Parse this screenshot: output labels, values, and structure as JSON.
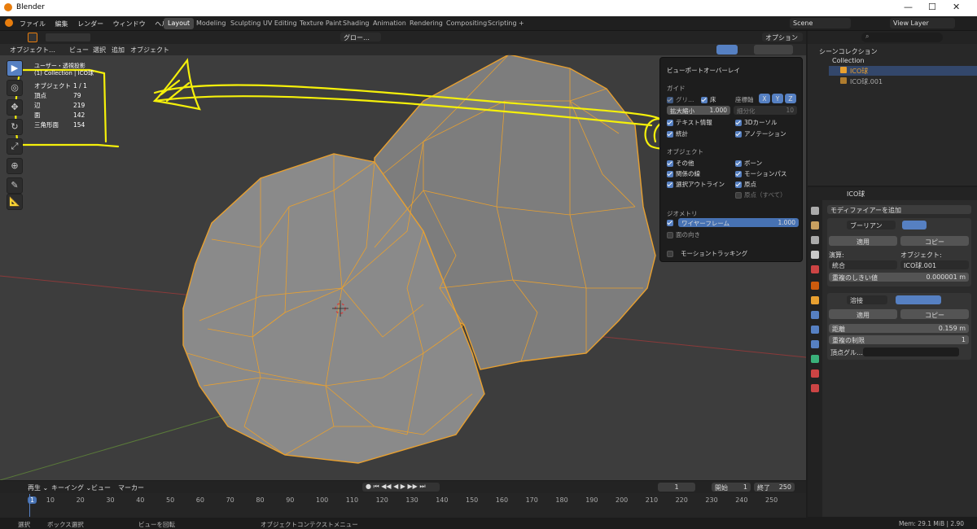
{
  "app": {
    "title": "Blender",
    "window_controls": [
      "—",
      "☐",
      "✕"
    ]
  },
  "menu": [
    "ファイル",
    "編集",
    "レンダー",
    "ウィンドウ",
    "ヘルプ"
  ],
  "workspaces": [
    {
      "label": "Layout",
      "active": true
    },
    {
      "label": "Modeling"
    },
    {
      "label": "Sculpting"
    },
    {
      "label": "UV Editing"
    },
    {
      "label": "Texture Paint"
    },
    {
      "label": "Shading"
    },
    {
      "label": "Animation"
    },
    {
      "label": "Rendering"
    },
    {
      "label": "Compositing"
    },
    {
      "label": "Scripting"
    },
    {
      "label": "+"
    }
  ],
  "scene": {
    "name": "Scene",
    "view_layer": "View Layer"
  },
  "viewport_header": {
    "mode": "オブジェクト…",
    "menus": [
      "ビュー",
      "選択",
      "追加",
      "オブジェクト"
    ],
    "orientation": "グロー…",
    "options": "オプション ⌄"
  },
  "viewport_info": {
    "line1": "ユーザー・透視投影",
    "line2": "(1) Collection | ICO球"
  },
  "stats": [
    {
      "label": "オブジェクト",
      "value": "1 / 1"
    },
    {
      "label": "頂点",
      "value": "79"
    },
    {
      "label": "辺",
      "value": "219"
    },
    {
      "label": "面",
      "value": "142"
    },
    {
      "label": "三角形面",
      "value": "154"
    }
  ],
  "overlay_panel": {
    "title": "ビューポートオーバーレイ",
    "guides_label": "ガイド",
    "grid": "グリ…",
    "floor": "床",
    "axes_label": "座標軸",
    "axes": [
      "X",
      "Y",
      "Z"
    ],
    "scale_label": "拡大縮小",
    "scale_value": "1.000",
    "subdiv_label": "細分化",
    "subdiv_value": "10",
    "text_info": "テキスト情報",
    "cursor3d": "3Dカーソル",
    "statistics": "統計",
    "annotation": "アノテーション",
    "objects_label": "オブジェクト",
    "extras": "その他",
    "bones": "ボーン",
    "relations": "関係の線",
    "motion_paths": "モーションパス",
    "outline_selected": "選択アウトライン",
    "origins": "原点",
    "origins_all": "原点（すべて）",
    "geometry_label": "ジオメトリ",
    "wireframe": "ワイヤーフレーム",
    "wireframe_value": "1.000",
    "face_orientation": "面の向き",
    "motion_tracking": "モーショントラッキング"
  },
  "outliner": {
    "root": "シーンコレクション",
    "collection": "Collection",
    "items": [
      "ICO球",
      "ICO球.001"
    ]
  },
  "properties": {
    "object_name": "ICO球",
    "add_modifier": "モディファイアーを追加",
    "mod1": {
      "name": "ブーリアン",
      "apply": "適用",
      "copy": "コピー",
      "op_label": "演算:",
      "op_value": "統合",
      "obj_label": "オブジェクト:",
      "obj_value": "ICO球.001",
      "threshold_label": "重複のしきい値",
      "threshold_value": "0.000001 m"
    },
    "mod2": {
      "name": "溶接",
      "apply": "適用",
      "copy": "コピー",
      "dist_label": "距離",
      "dist_value": "0.159 m",
      "dup_label": "重複の制限",
      "dup_value": "1",
      "vgroup_label": "頂点グル…"
    }
  },
  "timeline": {
    "menus": [
      "再生 ⌄",
      "キーイング ⌄",
      "ビュー",
      "マーカー"
    ],
    "frame": "1",
    "start_label": "開始",
    "start": "1",
    "end_label": "終了",
    "end": "250",
    "ticks": [
      "1",
      "10",
      "20",
      "30",
      "40",
      "50",
      "60",
      "70",
      "80",
      "90",
      "100",
      "110",
      "120",
      "130",
      "140",
      "150",
      "160",
      "170",
      "180",
      "190",
      "200",
      "210",
      "220",
      "230",
      "240",
      "250"
    ]
  },
  "status": {
    "select": "選択",
    "box": "ボックス選択",
    "rotate": "ビューを回転",
    "context": "オブジェクトコンテクストメニュー",
    "mem": "Mem: 29.1 MiB | 2.90"
  },
  "colors": {
    "accent": "#5680c2",
    "orange": "#e8a030",
    "annotation": "#f5f00a"
  }
}
